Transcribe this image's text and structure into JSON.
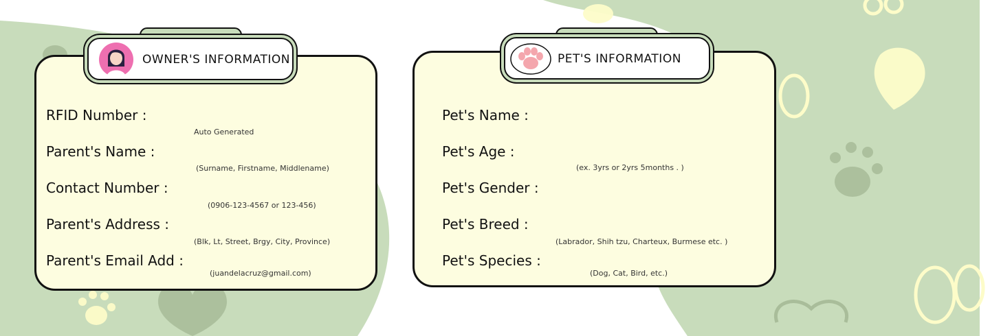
{
  "owner_section": {
    "title": "OWNER'S  INFORMATION",
    "fields": [
      {
        "label": "RFID Number :",
        "hint": "Auto Generated"
      },
      {
        "label": "Parent's Name :",
        "hint": "(Surname, Firstname, Middlename)"
      },
      {
        "label": "Contact Number :",
        "hint": "(0906-123-4567 or 123-456)"
      },
      {
        "label": "Parent's Address :",
        "hint": "(Blk, Lt, Street, Brgy, City, Province)"
      },
      {
        "label": "Parent's Email Add :",
        "hint": "(juandelacruz@gmail.com)"
      }
    ]
  },
  "pet_section": {
    "title": "PET'S INFORMATION",
    "fields": [
      {
        "label": "Pet's Name :",
        "hint": ""
      },
      {
        "label": "Pet's Age :",
        "hint": "(ex. 3yrs or 2yrs 5months . )"
      },
      {
        "label": "Pet's Gender :",
        "hint": ""
      },
      {
        "label": "Pet's Breed :",
        "hint": "(Labrador, Shih tzu, Charteux, Burmese etc. )"
      },
      {
        "label": "Pet's Species :",
        "hint": "(Dog, Cat, Bird, etc.)"
      }
    ]
  },
  "colors": {
    "background_green": "#c8dcbb",
    "card_fill": "#fdfde0",
    "paw_pink": "#f4a6ad",
    "avatar_pink": "#ee6fb0"
  }
}
